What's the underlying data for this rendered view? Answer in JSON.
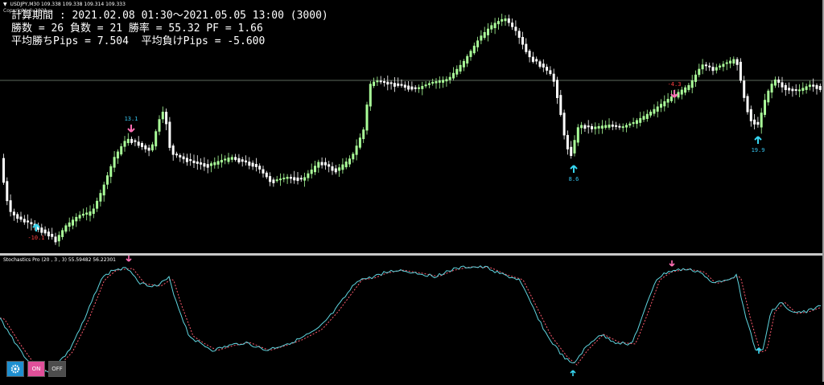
{
  "symbol": {
    "name": "USDJPY,M30",
    "prices": "109.338 109.338 109.314 109.333"
  },
  "copyright": "Copyright © 2021 ...",
  "stats": {
    "line1": "計算期間 : 2021.02.08 01:30～2021.05.05 13:00 (3000)",
    "line2": "勝数 = 26 負数 = 21 勝率 = 55.32 PF = 1.66",
    "line3": "平均勝ちPips = 7.504  平均負けPips = -5.600"
  },
  "signals": [
    {
      "label": "-10.1",
      "type": "buy",
      "color": "#ff4040"
    },
    {
      "label": "13.1",
      "type": "sell",
      "color": "#37c6f0"
    },
    {
      "label": "8.6",
      "type": "buy",
      "color": "#37c6f0"
    },
    {
      "label": "-4.3",
      "type": "sell",
      "color": "#ff4040"
    },
    {
      "label": "19.9",
      "type": "buy",
      "color": "#37c6f0"
    }
  ],
  "indicator": {
    "title": "Stochastics Pro (20 , 3 , 3) 55.59482 56.22301"
  },
  "buttons": {
    "settings": "gear-icon",
    "on": "ON",
    "off": "OFF"
  },
  "colors": {
    "bull": "#aaff99",
    "bear": "#ffffff",
    "main_line": "#5fd6e0",
    "signal_line": "#ff5a6e",
    "up_arrow": "#37d6f0",
    "down_arrow": "#ff6eb4",
    "hline": "#7a8a7a"
  }
}
